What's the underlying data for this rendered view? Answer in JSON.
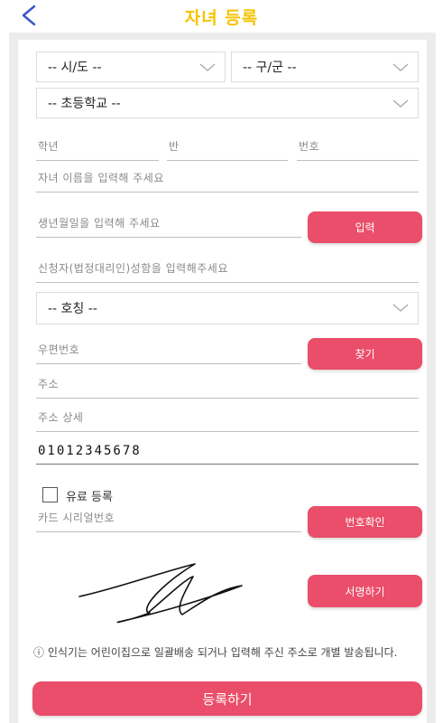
{
  "header": {
    "title": "자녀 등록"
  },
  "region": {
    "sido_selected": "-- 시/도 --",
    "gugun_selected": "-- 구/군 --",
    "school_selected": "-- 초등학교 --"
  },
  "student": {
    "grade_placeholder": "학년",
    "class_placeholder": "반",
    "number_placeholder": "번호",
    "name_placeholder": "자녀 이름을 입력해 주세요",
    "birth_placeholder": "생년월일을 입력해 주세요",
    "birth_button": "입력"
  },
  "applicant": {
    "name_placeholder": "신청자(법정대리인)성함을 입력해주세요",
    "relation_selected": "-- 호칭 --"
  },
  "address": {
    "zip_placeholder": "우편번호",
    "zip_button": "찾기",
    "addr_placeholder": "주소",
    "detail_placeholder": "주소 상세",
    "phone_value": "01012345678"
  },
  "paid": {
    "checkbox_label": "유료 등록",
    "card_placeholder": "카드 시리얼번호",
    "card_button": "번호확인"
  },
  "signature": {
    "button": "서명하기"
  },
  "notice": "ⓘ 인식기는 어린이집으로 일괄배송 되거나 입력해 주신 주소로 개별 발송됩니다.",
  "submit_label": "등록하기",
  "colors": {
    "accent": "#ea4e6a",
    "title": "#f5c400",
    "back": "#3a57c9"
  }
}
